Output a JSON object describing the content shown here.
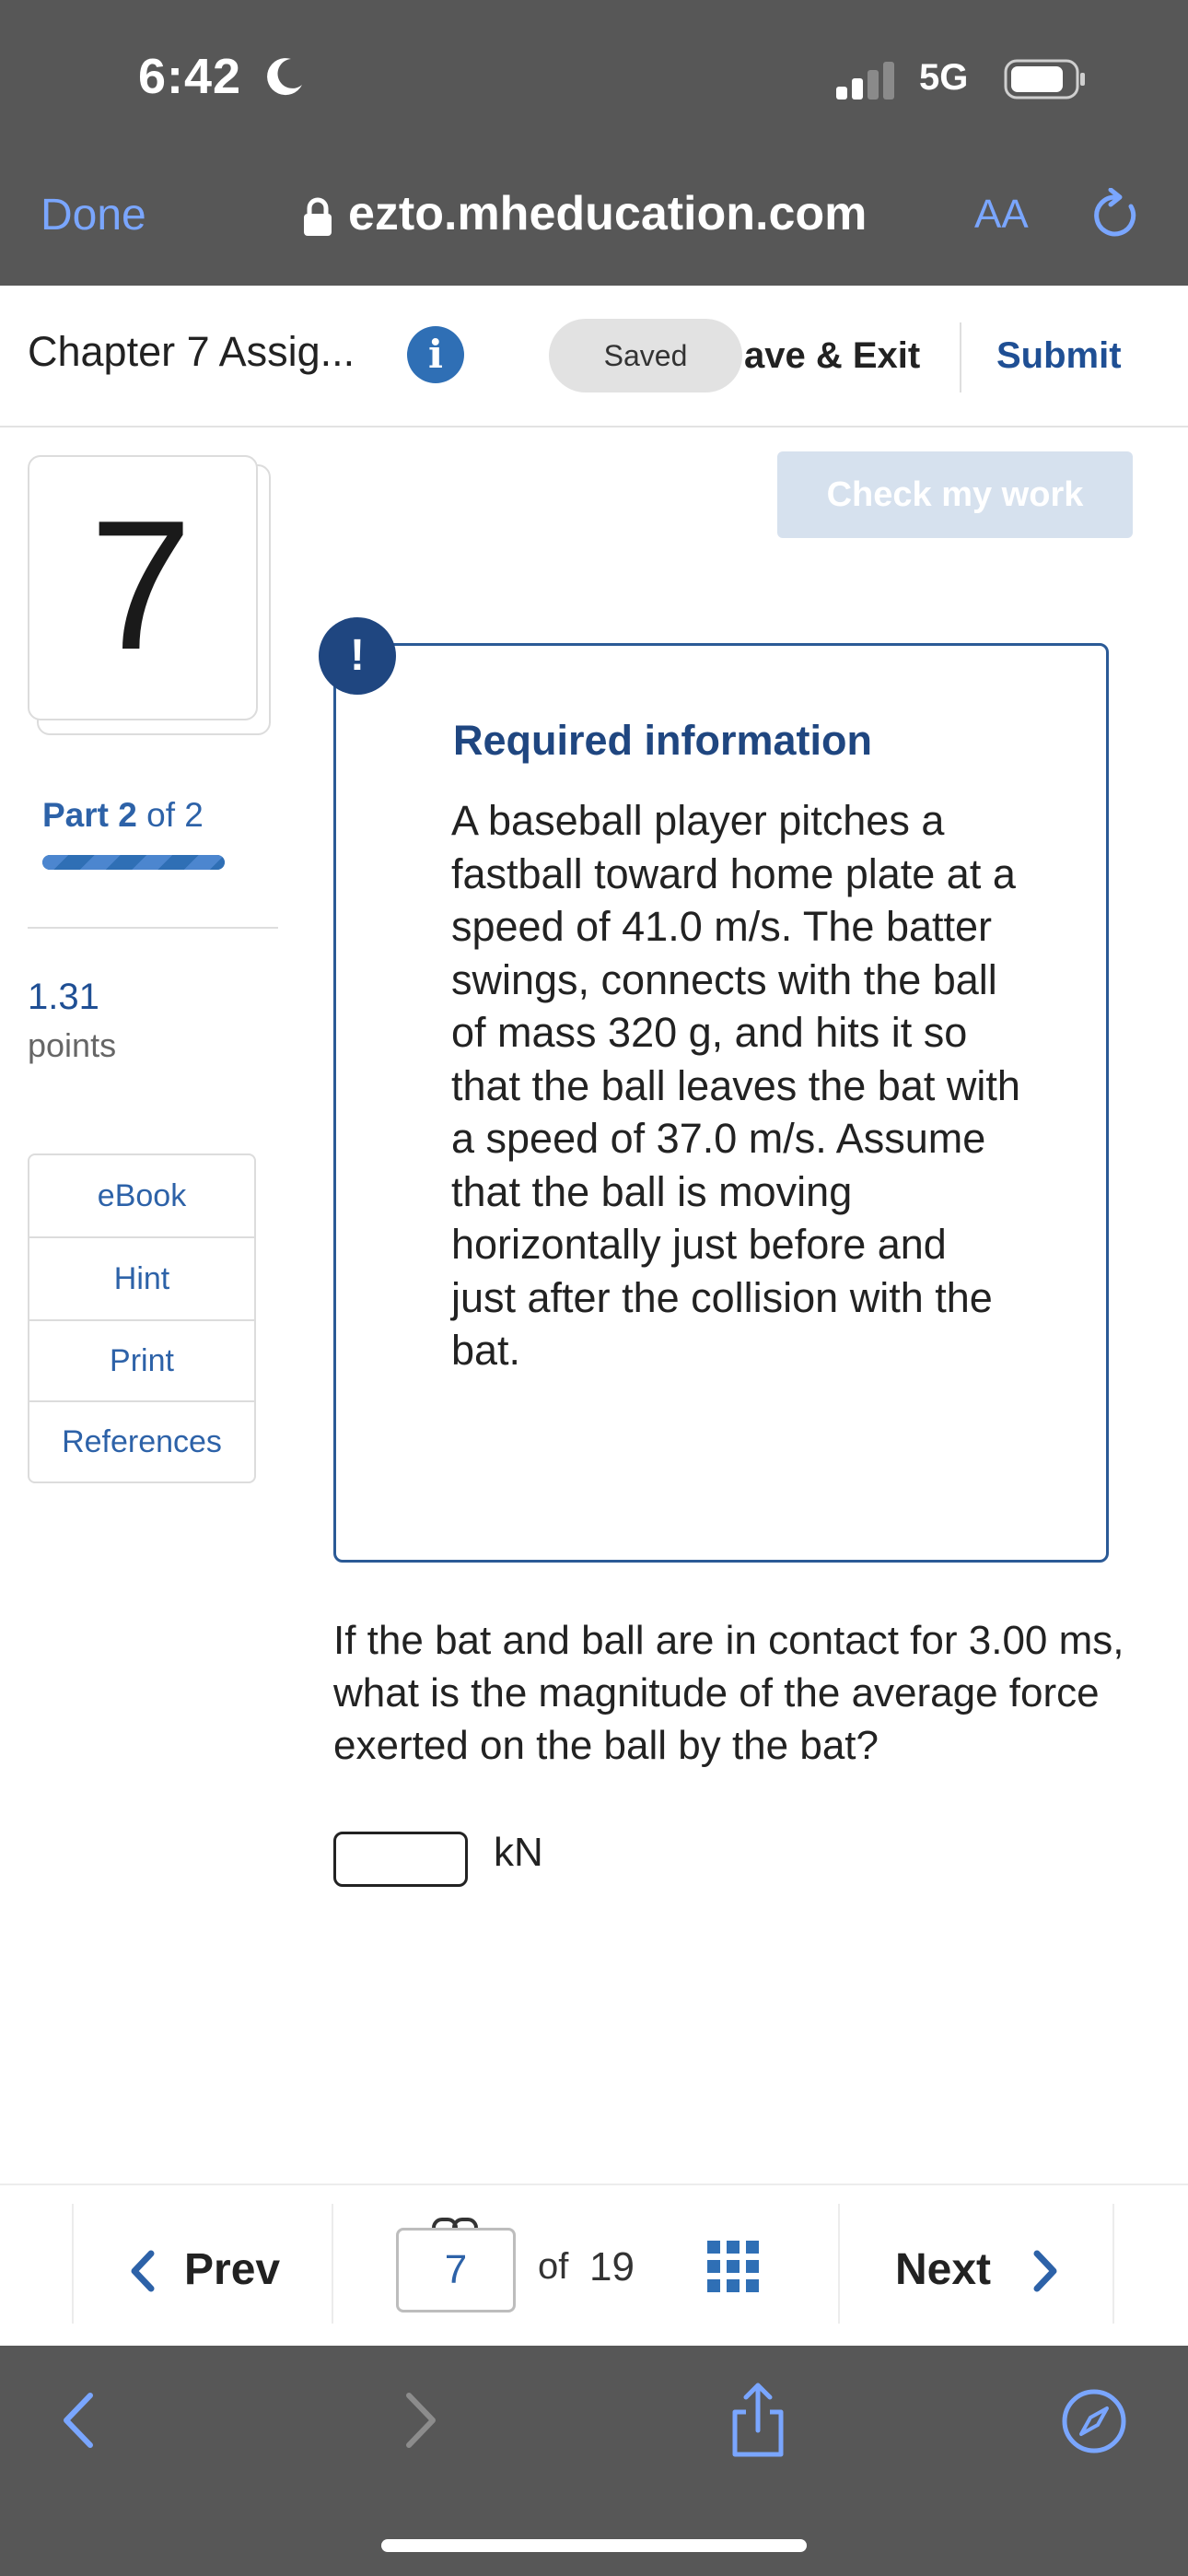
{
  "status_bar": {
    "time": "6:42",
    "network": "5G",
    "icons": [
      "moon-icon",
      "signal-icon",
      "battery-icon"
    ]
  },
  "browser": {
    "done_label": "Done",
    "url": "ezto.mheducation.com",
    "text_size_label": "AA",
    "icons": [
      "lock-icon",
      "reload-icon",
      "back-arrow-icon",
      "forward-arrow-icon",
      "share-icon",
      "compass-icon"
    ]
  },
  "header": {
    "chapter_title": "Chapter 7 Assig...",
    "info_glyph": "i",
    "saved_label": "Saved",
    "save_exit_label": "ave & Exit",
    "submit_label": "Submit"
  },
  "sidebar": {
    "question_number": "7",
    "part_word": "Part",
    "part_current": "2",
    "part_of": "of 2",
    "part_progress": 1.0,
    "points_value": "1.31",
    "points_label": "points",
    "resources": [
      "eBook",
      "Hint",
      "Print",
      "References"
    ]
  },
  "main": {
    "check_work_label": "Check my work",
    "alert_glyph": "!",
    "required_title": "Required information",
    "required_text": "A baseball player pitches a fastball toward home plate at a speed of 41.0 m/s. The batter swings, connects with the ball of mass 320 g, and hits it so that the ball leaves the bat with a speed of 37.0 m/s. Assume that the ball is moving horizontally just before and just after the collision with the bat.",
    "question": "If the bat and ball are in contact for 3.00 ms, what is the magnitude of the average force exerted on the ball by the bat?",
    "answer_value": "",
    "unit": "kN"
  },
  "pager": {
    "prev_label": "Prev",
    "current_page": "7",
    "of_label": "of",
    "total_pages": "19",
    "next_label": "Next"
  },
  "colors": {
    "browser_chrome": "#575757",
    "accent_blue": "#2f6fb5",
    "link_blue": "#7aa6ff",
    "dark_blue": "#1f4680",
    "check_work_bg": "#d6e1ee"
  }
}
